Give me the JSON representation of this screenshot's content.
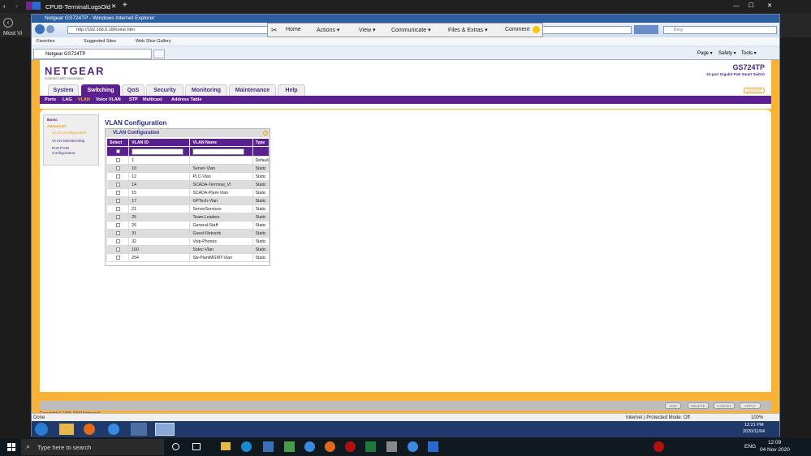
{
  "outer": {
    "tabs": [
      "CPUB-Terminal",
      "LogsOld"
    ],
    "side_label": "Most Vi",
    "clock_time": "12:09",
    "clock_date": "04 Nov 2020",
    "search_placeholder": "Type here to search",
    "lang": "ENG"
  },
  "ie": {
    "window_title": "Netgear GS724TP - Windows Internet Explorer",
    "address": "http://192.168.0.18/home.htm",
    "search_placeholder": "Bing",
    "command_bar": [
      "Home",
      "Actions",
      "View",
      "Communicate",
      "Files & Extras",
      "Comment"
    ],
    "favorites": [
      "Favorites",
      "Suggested Sites",
      "Web Slice Gallery"
    ],
    "page_tab": "Netgear GS724TP",
    "tools": [
      "Page",
      "Safety",
      "Tools"
    ],
    "status_left": "Done",
    "status_zone": "Internet | Protected Mode: Off",
    "zoom": "100%",
    "inner_clock_time": "12:21 PM",
    "inner_clock_date": "2020/11/04"
  },
  "netgear": {
    "logo": "NETGEAR",
    "tagline": "Connect with Innovation",
    "model": "GS724TP",
    "model_desc": "24-port Gigabit PoE Smart Switch",
    "logout": "LOGOUT",
    "main_tabs": [
      "System",
      "Switching",
      "QoS",
      "Security",
      "Monitoring",
      "Maintenance",
      "Help"
    ],
    "sub_nav": [
      "Ports",
      "LAG",
      "VLAN",
      "Voice VLAN",
      "STP",
      "Multicast",
      "Address Table"
    ],
    "side": {
      "basic": "Basic",
      "advanced": "Advanced",
      "items": [
        "VLAN Configuration",
        "VLAN Membership",
        "Port PVID Configuration"
      ]
    },
    "page_title": "VLAN Configuration",
    "box_title": "VLAN Configuration",
    "columns": [
      "Select",
      "VLAN ID",
      "VLAN Name",
      "Type"
    ],
    "rows": [
      {
        "id": "1",
        "name": "",
        "type": "Default"
      },
      {
        "id": "10",
        "name": "Server-Vlan",
        "type": "Static"
      },
      {
        "id": "12",
        "name": "PLC-Vlan",
        "type": "Static"
      },
      {
        "id": "14",
        "name": "SCADA-Terminal_Vl",
        "type": "Static"
      },
      {
        "id": "15",
        "name": "SCADA-Plant-Vlan",
        "type": "Static"
      },
      {
        "id": "17",
        "name": "GPTech-Vlan",
        "type": "Static"
      },
      {
        "id": "21",
        "name": "ServerServices",
        "type": "Static"
      },
      {
        "id": "25",
        "name": "Team-Leaders",
        "type": "Static"
      },
      {
        "id": "26",
        "name": "General-Staff",
        "type": "Static"
      },
      {
        "id": "31",
        "name": "Guest-Network",
        "type": "Static"
      },
      {
        "id": "32",
        "name": "Voip-Phones",
        "type": "Static"
      },
      {
        "id": "100",
        "name": "Sotec-Vlan",
        "type": "Static"
      },
      {
        "id": "254",
        "name": "Sw-PlantMGMT-Vlan",
        "type": "Static"
      }
    ],
    "buttons": [
      "ADD",
      "DELETE",
      "CANCEL",
      "APPLY"
    ],
    "copyright": "Copyright © 1996-2009 Netgear®"
  }
}
